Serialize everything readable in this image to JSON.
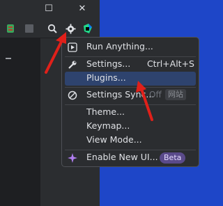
{
  "window": {
    "controls": {
      "maximize_glyph": "☐",
      "close_glyph": "✕"
    }
  },
  "toolbar": {
    "icons": [
      "run-config-icon",
      "stop-icon",
      "search-icon",
      "gear-icon",
      "jetbrains-toolbox-icon"
    ]
  },
  "menu": {
    "items": [
      {
        "label": "Run Anything...",
        "icon": "run-anything-icon"
      },
      {
        "label": "Settings...",
        "shortcut": "Ctrl+Alt+S",
        "icon": "wrench-icon"
      },
      {
        "label": "Plugins...",
        "selected": true
      },
      {
        "label": "Settings Sync...",
        "badge_off": "Off",
        "badge_cn": "网站",
        "icon": "sync-disabled-icon"
      },
      {
        "label": "Theme..."
      },
      {
        "label": "Keymap..."
      },
      {
        "label": "View Mode..."
      },
      {
        "label": "Enable New UI...",
        "badge": "Beta",
        "icon": "sparkle-icon"
      }
    ]
  },
  "colors": {
    "desktop": "#1e46c8",
    "panel": "#2b2d30",
    "selection": "#2e436e",
    "annotation_arrow": "#e0201a"
  }
}
